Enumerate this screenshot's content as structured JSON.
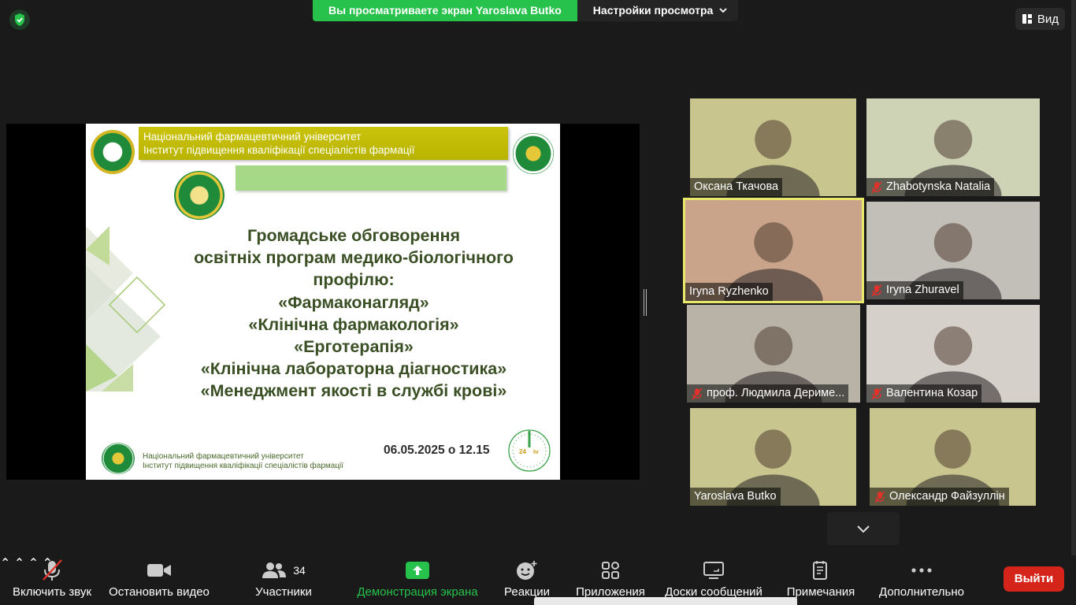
{
  "window": {
    "share_banner": "Вы просматриваете экран Yaroslava Butko",
    "view_options": "Настройки просмотра",
    "view_button": "Вид"
  },
  "slide": {
    "header_line1": "Національний фармацевтичний університет",
    "header_line2": "Інститут підвищення кваліфікації спеціалістів фармації",
    "title_lines": [
      "Громадське обговорення",
      "освітніх програм медико-біологічного",
      "профілю:",
      "«Фармаконагляд»",
      "«Клінічна фармакологія»",
      "«Ерготерапія»",
      "«Клінічна лабораторна діагностика»",
      "«Менеджмент якості в службі крові»"
    ],
    "date": "06.05.2025 о 12.15",
    "footer_line1": "Національний фармацевтичний університет",
    "footer_line2": "Інститут підвищення кваліфікації спеціалістів фармації",
    "clock_label": "24",
    "clock_unit": "hr"
  },
  "participants": [
    {
      "name": "Оксана Ткачова",
      "muted": false,
      "bg": "#c9c58e"
    },
    {
      "name": "Zhabotynska Natalia",
      "muted": true,
      "bg": "#cfd3b6"
    },
    {
      "name": "Iryna Ryzhenko",
      "muted": false,
      "bg": "#c9a48a",
      "active": true
    },
    {
      "name": "Iryna Zhuravel",
      "muted": true,
      "bg": "#c2bfb9"
    },
    {
      "name": "проф. Людмила Дериме...",
      "muted": true,
      "bg": "#b9b3a7"
    },
    {
      "name": "Валентина Козар",
      "muted": true,
      "bg": "#d6d0cb"
    },
    {
      "name": "Yaroslava Butko",
      "muted": false,
      "bg": "#c9c58e"
    },
    {
      "name": "Олександр Файзуллін",
      "muted": true,
      "bg": "#c9c58e"
    }
  ],
  "toolbar": {
    "audio": "Включить звук",
    "video": "Остановить видео",
    "participants": "Участники",
    "participants_count": "34",
    "share": "Демонстрация экрана",
    "reactions": "Реакции",
    "apps": "Приложения",
    "whiteboards": "Доски сообщений",
    "notes": "Примечания",
    "more": "Дополнительно",
    "leave": "Выйти"
  }
}
